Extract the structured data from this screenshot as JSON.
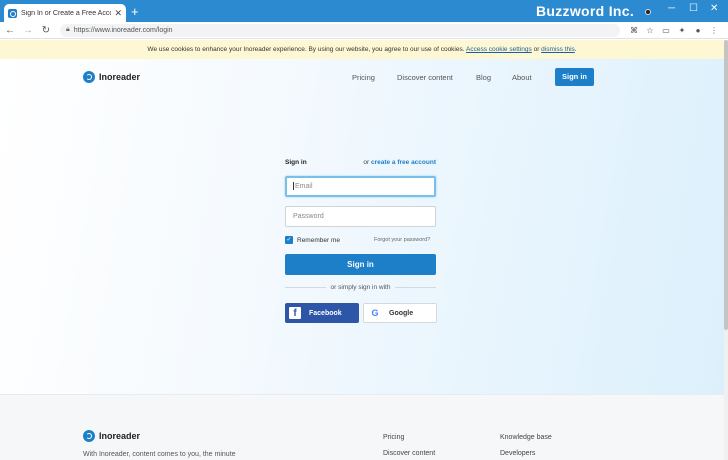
{
  "browser": {
    "tab_title": "Sign In or Create a Free Account",
    "tab_close": "✕",
    "new_tab": "+",
    "url": "https://www.inoreader.com/login",
    "overlay_brand": "Buzzword Inc."
  },
  "cookie_banner": {
    "text_before": "We use cookies to enhance your Inoreader experience. By using our website, you agree to our use of cookies.",
    "settings_link": "Access cookie settings",
    "or": "or",
    "dismiss_link": "dismiss this",
    "end": "."
  },
  "header": {
    "brand": "Inoreader",
    "nav": [
      "Pricing",
      "Discover content",
      "Blog",
      "About"
    ],
    "signin_button": "Sign in"
  },
  "form": {
    "title": "Sign in",
    "or_text": "or",
    "create_link": "create a free account",
    "email_placeholder": "Email",
    "password_placeholder": "Password",
    "remember_label": "Remember me",
    "remember_checked": true,
    "forgot_link": "Forgot your password?",
    "submit": "Sign in",
    "divider": "or simply sign in with",
    "facebook": "Facebook",
    "google": "Google"
  },
  "footer": {
    "brand": "Inoreader",
    "tagline": "With Inoreader, content comes to you, the minute",
    "col1": [
      "Pricing",
      "Discover content"
    ],
    "col2": [
      "Knowledge base",
      "Developers"
    ]
  },
  "colors": {
    "accent": "#1e7fc9",
    "titlebar": "#2b8ad0",
    "facebook": "#2d56a8",
    "cookie_bg": "#fdf7d4"
  }
}
